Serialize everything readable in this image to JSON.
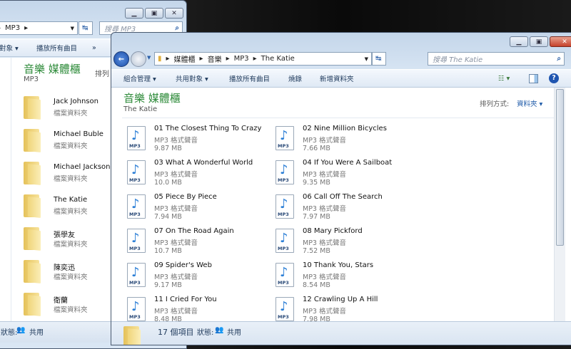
{
  "back_window": {
    "address": [
      "MP3"
    ],
    "search_placeholder": "搜尋 MP3",
    "toolbar": {
      "share": "對象",
      "play_all": "播放所有曲目",
      "more": "»"
    },
    "library_title": "音樂 媒體櫃",
    "subtitle": "MP3",
    "arrange_partial": "排列",
    "items": [
      {
        "name": "Jack Johnson",
        "type": "檔案資料夾"
      },
      {
        "name": "Michael Buble",
        "type": "檔案資料夾"
      },
      {
        "name": "Michael Jackson",
        "type": "檔案資料夾"
      },
      {
        "name": "The Katie",
        "type": "檔案資料夾"
      },
      {
        "name": "張學友",
        "type": "檔案資料夾"
      },
      {
        "name": "陳奕迅",
        "type": "檔案資料夾"
      },
      {
        "name": "衛蘭",
        "type": "檔案資料夾"
      }
    ],
    "status": {
      "state_label": "狀態:",
      "state": "共用"
    }
  },
  "front_window": {
    "breadcrumb": [
      "媒體櫃",
      "音樂",
      "MP3",
      "The Katie"
    ],
    "search_placeholder": "搜尋 The Katie",
    "toolbar": {
      "organize": "組合管理 ▾",
      "share": "共用對象 ▾",
      "play_all": "播放所有曲目",
      "burn": "燒錄",
      "new_folder": "新增資料夾"
    },
    "library_title": "音樂 媒體櫃",
    "subtitle": "The Katie",
    "arrange_label": "排列方式:",
    "arrange_value": "資料夾 ▾",
    "file_type_badge": "MP3",
    "files": [
      {
        "name": "01 The Closest Thing To Crazy",
        "type": "MP3 格式聲音",
        "size": "9.87 MB"
      },
      {
        "name": "02 Nine Million Bicycles",
        "type": "MP3 格式聲音",
        "size": "7.66 MB"
      },
      {
        "name": "03 What A Wonderful World",
        "type": "MP3 格式聲音",
        "size": "10.0 MB"
      },
      {
        "name": "04 If You Were A Sailboat",
        "type": "MP3 格式聲音",
        "size": "9.35 MB"
      },
      {
        "name": "05 Piece By Piece",
        "type": "MP3 格式聲音",
        "size": "7.94 MB"
      },
      {
        "name": "06 Call Off The Search",
        "type": "MP3 格式聲音",
        "size": "7.97 MB"
      },
      {
        "name": "07 On The Road Again",
        "type": "MP3 格式聲音",
        "size": "10.7 MB"
      },
      {
        "name": "08 Mary Pickford",
        "type": "MP3 格式聲音",
        "size": "7.52 MB"
      },
      {
        "name": "09 Spider's Web",
        "type": "MP3 格式聲音",
        "size": "9.17 MB"
      },
      {
        "name": "10 Thank You, Stars",
        "type": "MP3 格式聲音",
        "size": "8.54 MB"
      },
      {
        "name": "11 I Cried For You",
        "type": "MP3 格式聲音",
        "size": "8.48 MB"
      },
      {
        "name": "12 Crawling Up A Hill",
        "type": "MP3 格式聲音",
        "size": "7.98 MB"
      }
    ],
    "status": {
      "count": "17 個項目",
      "state_label": "狀態:",
      "state": "共用"
    }
  }
}
